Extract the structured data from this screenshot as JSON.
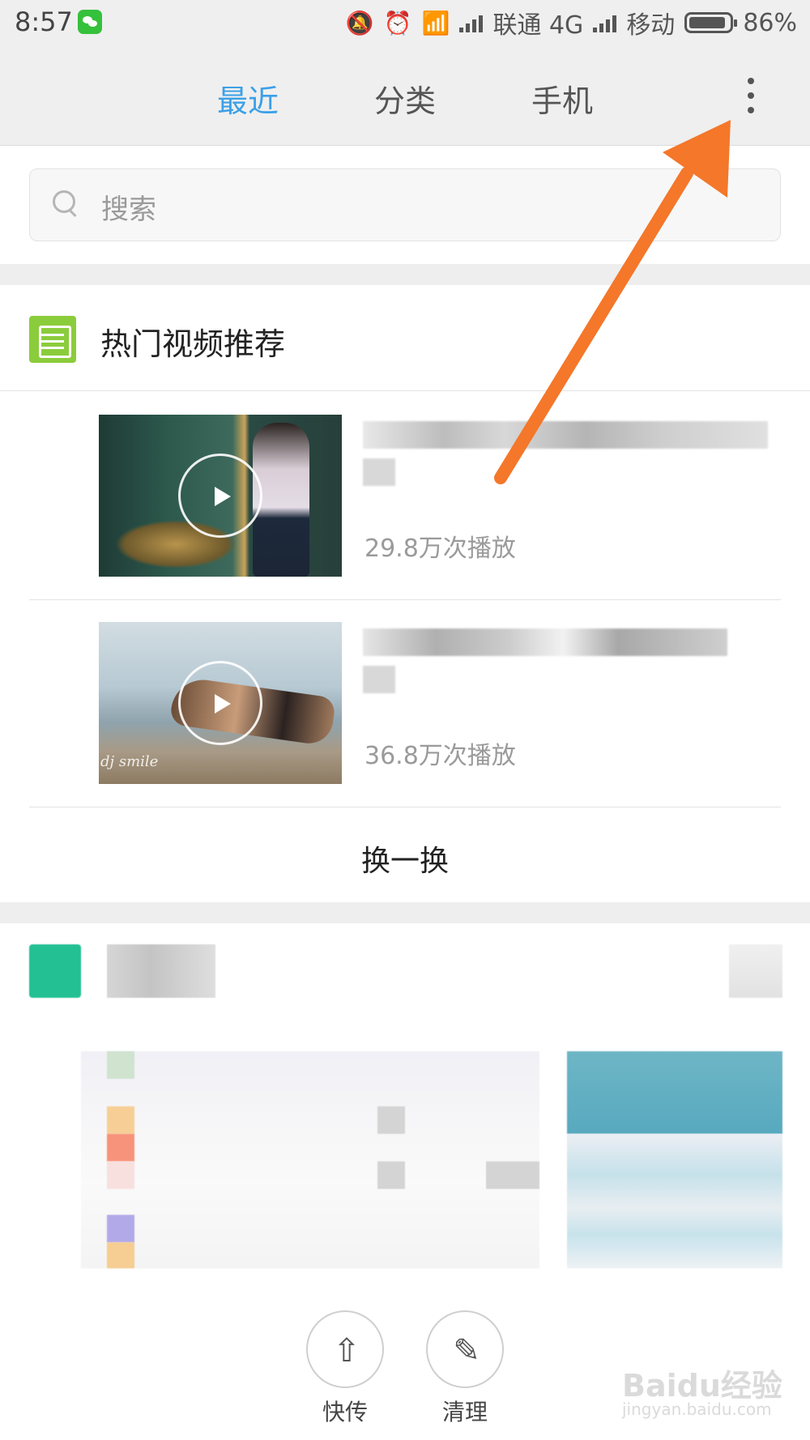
{
  "status_bar": {
    "time": "8:57",
    "carrier1": "联通 4G",
    "carrier2": "移动",
    "battery": "86%"
  },
  "tabs": [
    {
      "label": "最近",
      "active": true
    },
    {
      "label": "分类",
      "active": false
    },
    {
      "label": "手机",
      "active": false
    }
  ],
  "colors": {
    "accent": "#3aa0e8",
    "section_icon": "#8bcc3c",
    "arrow": "#f4772a"
  },
  "search": {
    "placeholder": "搜索"
  },
  "section": {
    "title": "热门视频推荐",
    "icon": "document-icon"
  },
  "videos": [
    {
      "views": "29.8万次播放"
    },
    {
      "views": "36.8万次播放",
      "thumbnail_caption": "dj smile"
    }
  ],
  "refresh_label": "换一换",
  "actions": [
    {
      "label": "快传",
      "icon": "upload-icon"
    },
    {
      "label": "清理",
      "icon": "broom-icon"
    }
  ],
  "watermark": {
    "text": "Baidu经验",
    "sub": "jingyan.baidu.com"
  }
}
